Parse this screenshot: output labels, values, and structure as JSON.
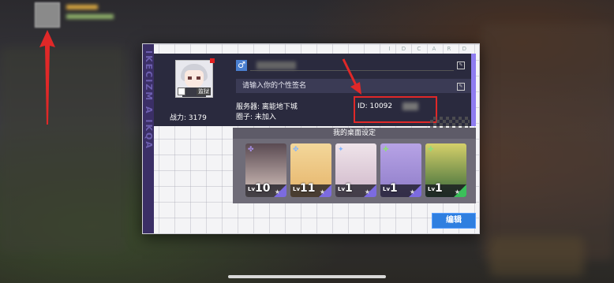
{
  "profile": {
    "avatar_badge": "监狱",
    "power_label": "战力:",
    "power_value": "3179",
    "gender_symbol": "♂",
    "signature_placeholder": "请输入你的个性签名",
    "server_label": "服务器:",
    "server_value": "离能地下城",
    "circle_label": "圈子:",
    "circle_value": "未加入",
    "id_label": "ID:",
    "id_value": "10092"
  },
  "panel": {
    "side_text": "IKECIZM A IKQA",
    "top_label": "I D C A R D"
  },
  "desktop": {
    "title": "我的桌面设定",
    "cards": [
      {
        "level_prefix": "Lv",
        "level": "10",
        "role_icon": "✤",
        "role_color": "#a88fe8",
        "corner_color": "#7c6be0",
        "art_top": "#5a4a52",
        "art_bottom": "#d9c7c0",
        "star": "★"
      },
      {
        "level_prefix": "Lv",
        "level": "11",
        "role_icon": "✥",
        "role_color": "#7fb4ff",
        "corner_color": "#7c6be0",
        "art_top": "#f3d79a",
        "art_bottom": "#e6b46a",
        "star": "★"
      },
      {
        "level_prefix": "Lv",
        "level": "1",
        "role_icon": "✦",
        "role_color": "#7fb4ff",
        "corner_color": "#7c6be0",
        "art_top": "#efe4ea",
        "art_bottom": "#cfb7c9",
        "star": "★"
      },
      {
        "level_prefix": "Lv",
        "level": "1",
        "role_icon": "✚",
        "role_color": "#8fdc7a",
        "corner_color": "#7c6be0",
        "art_top": "#b7a3e6",
        "art_bottom": "#8e7cc8",
        "star": "★"
      },
      {
        "level_prefix": "Lv",
        "level": "1",
        "role_icon": "✚",
        "role_color": "#8fdc7a",
        "corner_color": "#3bbf5a",
        "art_top": "#d5d06a",
        "art_bottom": "#3a6a3a",
        "star": "★"
      }
    ],
    "edit_label": "编辑"
  },
  "colors": {
    "annotation_red": "#e02828",
    "edit_button_blue": "#2f7fe0"
  }
}
